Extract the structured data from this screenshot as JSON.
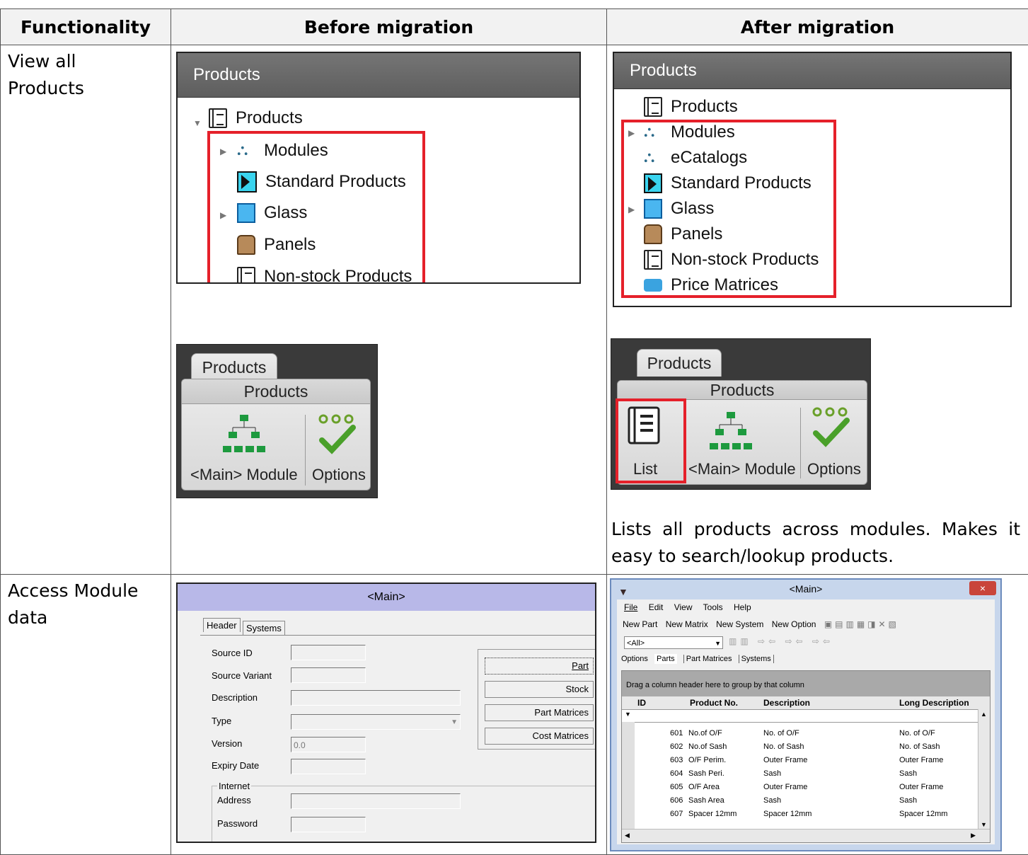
{
  "table": {
    "headers": [
      "Functionality",
      "Before migration",
      "After migration"
    ],
    "row1_label": "View all Products",
    "row2_label": "Access Module data",
    "row1_note": "Lists all products across modules. Makes it easy to search/lookup products."
  },
  "before_tree": {
    "header": "Products",
    "root": "Products",
    "items": [
      "Modules",
      "Standard Products",
      "Glass",
      "Panels",
      "Non-stock Products"
    ]
  },
  "after_tree": {
    "header": "Products",
    "items": [
      "Products",
      "Modules",
      "eCatalogs",
      "Standard Products",
      "Glass",
      "Panels",
      "Non-stock Products",
      "Price Matrices"
    ]
  },
  "before_ribbon": {
    "tab": "Products",
    "group": "Products",
    "buttons": [
      "<Main> Module",
      "Options"
    ]
  },
  "after_ribbon": {
    "tab": "Products",
    "group": "Products",
    "buttons": [
      "List",
      "<Main> Module",
      "Options"
    ]
  },
  "before_dialog": {
    "title": "<Main>",
    "tabs": [
      "Header",
      "Systems"
    ],
    "fields": [
      "Source ID",
      "Source Variant",
      "Description",
      "Type",
      "Version",
      "Expiry Date"
    ],
    "version_value": "0.0",
    "internet_group": "Internet",
    "internet_fields": [
      "Address",
      "Password"
    ],
    "buttons": [
      "Part",
      "Stock",
      "Part Matrices",
      "Cost Matrices"
    ]
  },
  "after_window": {
    "title": "<Main>",
    "close": "×",
    "menu": [
      "File",
      "Edit",
      "View",
      "Tools",
      "Help"
    ],
    "toolbar": [
      "New Part",
      "New Matrix",
      "New System",
      "New Option"
    ],
    "filter_value": "<All>",
    "tabs": [
      "Options",
      "Parts",
      "Part Matrices",
      "Systems"
    ],
    "group_hint": "Drag a column header here to group by that column",
    "columns": [
      "ID",
      "Product No.",
      "Description",
      "Long Description"
    ],
    "rows": [
      [
        "601",
        "No.of O/F",
        "No. of O/F",
        "No. of O/F"
      ],
      [
        "602",
        "No.of Sash",
        "No. of Sash",
        "No. of Sash"
      ],
      [
        "603",
        "O/F Perim.",
        "Outer Frame",
        "Outer Frame"
      ],
      [
        "604",
        "Sash Peri.",
        "Sash",
        "Sash"
      ],
      [
        "605",
        "O/F Area",
        "Outer Frame",
        "Outer Frame"
      ],
      [
        "606",
        "Sash Area",
        "Sash",
        "Sash"
      ],
      [
        "607",
        "Spacer 12mm",
        "Spacer 12mm",
        "Spacer 12mm"
      ]
    ]
  },
  "colors": {
    "highlight": "#e5202a",
    "tree_header": "#6a6a6a",
    "dialog_title": "#b8b8e8"
  }
}
